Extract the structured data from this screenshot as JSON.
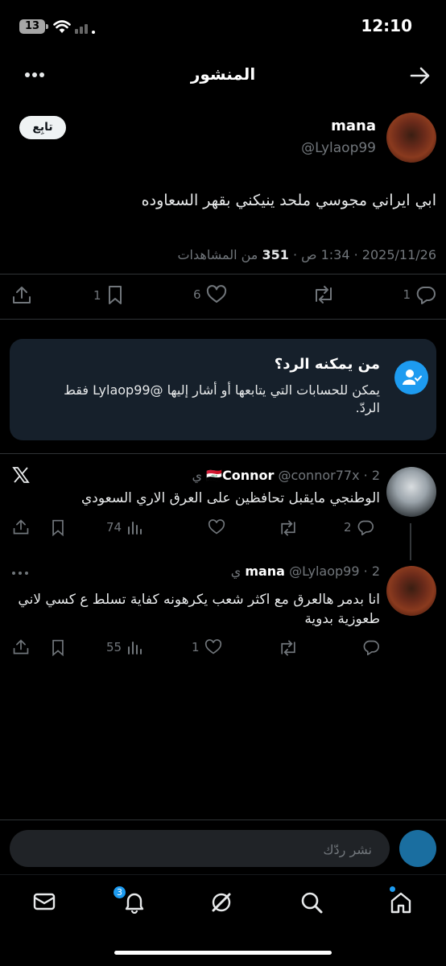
{
  "status_bar": {
    "time": "12:10",
    "battery": "13"
  },
  "header": {
    "title": "المنشور"
  },
  "post": {
    "author_name": "mana",
    "author_handle": "@Lylaop99",
    "follow_label": "تابِع",
    "text": "ابي ايراني مجوسي ملحد ينيكني بقهر السعاوده",
    "date": "2025/11/26",
    "time": "1:34 ص",
    "views_count": "351",
    "views_label": "من المشاهدات",
    "replies": "1",
    "likes": "6",
    "bookmarks": "1"
  },
  "reply_card": {
    "title": "من يمكنه الرد؟",
    "body": "يمكن للحسابات التي يتابعها أو أشار إليها @Lylaop99 فقط الردّ."
  },
  "replies": [
    {
      "name": "Connor",
      "flag": "🇮🇶",
      "handle": "@connor77x",
      "time": "2 ي",
      "text": "الوطنجي مايقبل تحافظين على العرق الاري السعودي",
      "replies": "2",
      "likes": "",
      "views": "74"
    },
    {
      "name": "mana",
      "handle": "@Lylaop99",
      "time": "2 ي",
      "text": "انا بدمر هالعرق مع اكثر شعب يكرهونه كفاية تسلط ع كسي لاني طعوزية بدوية",
      "replies": "",
      "likes": "1",
      "views": "55"
    }
  ],
  "composer": {
    "placeholder": "نشر ردّك"
  },
  "tabbar": {
    "notifications_badge": "3"
  },
  "colors": {
    "accent": "#1d9bf0",
    "background": "#000000",
    "card": "#16202b",
    "muted": "#71767b"
  }
}
